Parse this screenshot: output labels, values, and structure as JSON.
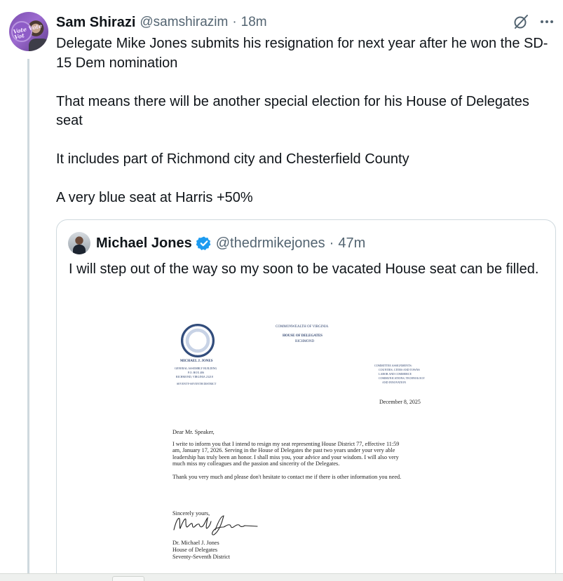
{
  "tweet": {
    "author_name": "Sam Shirazi",
    "author_handle": "@samshirazim",
    "separator": "·",
    "time": "18m",
    "avatar_sticker_text": "Vote Vote Vot",
    "text": "Delegate Mike Jones submits his resignation for next year after he won the SD-15 Dem nomination\n\nThat means there will be another special election for his House of Delegates seat\n\nIt includes part of Richmond city and Chesterfield County\n\nA very blue seat at Harris +50%",
    "icons": {
      "grok": "grok-icon",
      "more": "more-icon"
    }
  },
  "quote": {
    "author_name": "Michael Jones",
    "verified": true,
    "author_handle": "@thedrmikejones",
    "separator": "·",
    "time": "47m",
    "text": "I will step out of the way so my soon to be vacated House seat can be filled."
  },
  "letter": {
    "commonwealth": "COMMONWEALTH OF VIRGINIA",
    "house": "HOUSE OF DELEGATES",
    "city": "RICHMOND",
    "member_name": "MICHAEL J. JONES",
    "address_1": "GENERAL ASSEMBLY BUILDING",
    "address_2": "P.O. BOX 406",
    "address_3": "RICHMOND, VIRGINIA 23218",
    "district_caps": "SEVENTY-SEVENTH DISTRICT",
    "committees_1": "COMMITTEE ASSIGNMENTS:",
    "committees_2": "COUNTIES, CITIES AND TOWNS",
    "committees_3": "LABOR AND COMMERCE",
    "committees_4": "COMMUNICATIONS, TECHNOLOGY",
    "committees_5": "AND INNOVATION",
    "date": "December 8, 2025",
    "salutation": "Dear Mr. Speaker,",
    "para_1_lines": [
      "I write to inform you that I intend to resign my seat representing House District 77, effective 11:59",
      "am, January 17, 2026. Serving in the House of Delegates the past two years under your very able",
      "leadership has truly been an honor. I shall miss you, your advice and your wisdom. I will also very",
      "much miss my colleagues and the passion and sincerity of the Delegates."
    ],
    "para_2": "Thank you very much and please don't hesitate to contact me if there is other information you need.",
    "closing": "Sincerely yours,",
    "signature": "Michael J. Jones",
    "sign_name": "Dr. Michael J. Jones",
    "sign_title": "House of Delegates",
    "sign_district": "Seventy-Seventh District"
  },
  "colors": {
    "text": "#0f1419",
    "secondary": "#536471",
    "border": "#cfd9de",
    "verified": "#1d9bf0",
    "seal_blue": "#2f4a78"
  }
}
